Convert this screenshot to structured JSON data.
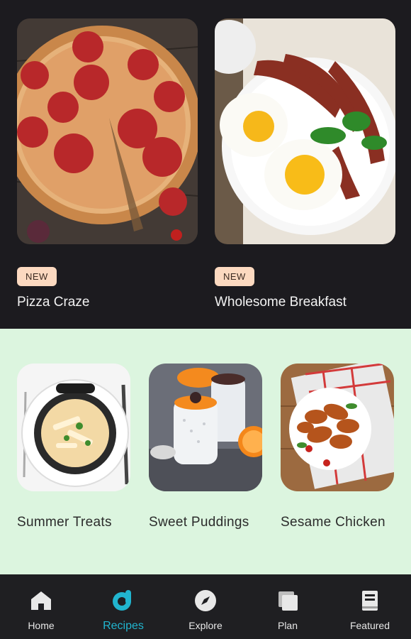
{
  "featured": [
    {
      "badge": "NEW",
      "title": "Pizza Craze",
      "image": "pepperoni-pizza"
    },
    {
      "badge": "NEW",
      "title": "Wholesome Breakfast",
      "image": "eggs-and-bacon"
    }
  ],
  "recommendations": [
    {
      "title": "Summer Treats",
      "image": "pasta-pot"
    },
    {
      "title": "Sweet Puddings",
      "image": "chia-puddings"
    },
    {
      "title": "Sesame Chicken",
      "image": "chicken-wings"
    }
  ],
  "nav": {
    "items": [
      {
        "label": "Home",
        "icon": "home-icon",
        "active": false
      },
      {
        "label": "Recipes",
        "icon": "recipes-icon",
        "active": true
      },
      {
        "label": "Explore",
        "icon": "compass-icon",
        "active": false
      },
      {
        "label": "Plan",
        "icon": "plan-icon",
        "active": false
      },
      {
        "label": "Featured",
        "icon": "book-icon",
        "active": false
      }
    ],
    "active_color": "#21b5cf"
  },
  "colors": {
    "dark_background": "#1c1b1f",
    "light_section": "#dcf5df",
    "badge_background": "#fcd9c0"
  }
}
